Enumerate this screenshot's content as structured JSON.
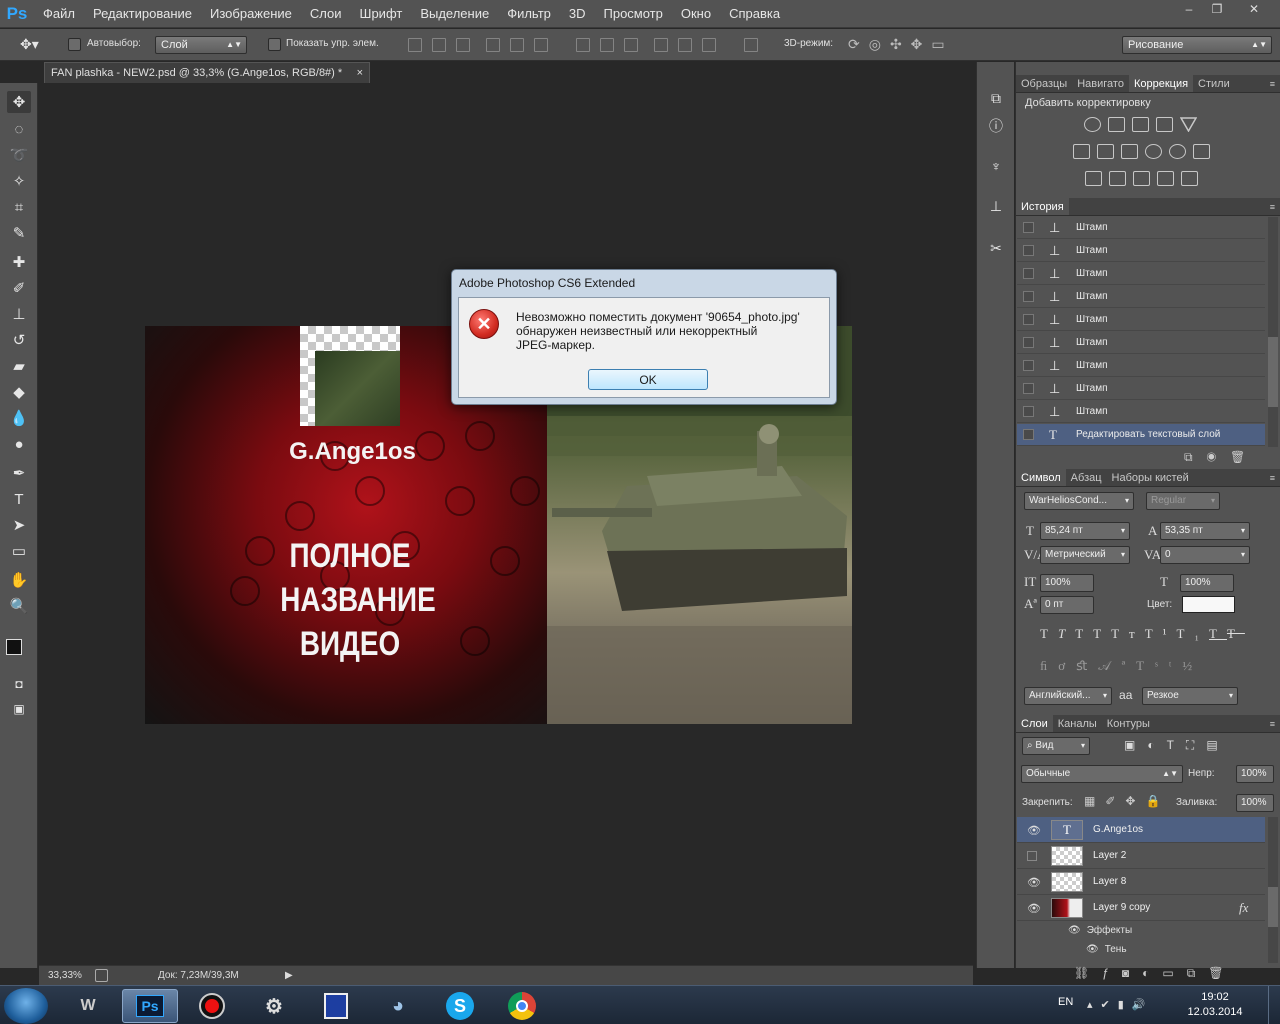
{
  "menubar": {
    "logo": "Ps",
    "items": [
      "Файл",
      "Редактирование",
      "Изображение",
      "Слои",
      "Шрифт",
      "Выделение",
      "Фильтр",
      "3D",
      "Просмотр",
      "Окно",
      "Справка"
    ],
    "window_buttons": {
      "minimize": "–",
      "maximize": "❐",
      "close": "✕"
    }
  },
  "options_bar": {
    "autoselect_label": "Автовыбор:",
    "autoselect_value": "Слой",
    "show_transform_label": "Показать упр. элем.",
    "mode_3d_label": "3D-режим:",
    "workspace_value": "Рисование"
  },
  "document": {
    "tab_title": "FAN plashka - NEW2.psd @ 33,3% (G.Ange1os, RGB/8#) *",
    "tab_close": "×",
    "zoom": "33,33%",
    "doc_size": "Док: 7,23M/39,3M"
  },
  "artwork": {
    "nickname": "G.Ange1os",
    "title_lines": [
      "ПОЛНОЕ",
      "НАЗВАНИЕ",
      "ВИДЕО"
    ]
  },
  "dialog": {
    "title": "Adobe Photoshop CS6 Extended",
    "icon": "error-icon",
    "message_line1": "Невозможно поместить документ '90654_photo.jpg'",
    "message_line2": "обнаружен неизвестный или некорректный",
    "message_line3": "JPEG-маркер.",
    "ok_label": "OK"
  },
  "panels": {
    "top_tabs": [
      "Образцы",
      "Навигато",
      "Коррекция",
      "Стили"
    ],
    "adjustments_heading": "Добавить корректировку",
    "history_tab": "История",
    "history_items": [
      "Штамп",
      "Штамп",
      "Штамп",
      "Штамп",
      "Штамп",
      "Штамп",
      "Штамп",
      "Штамп",
      "Штамп",
      "Редактировать текстовый слой"
    ],
    "char_tabs": [
      "Символ",
      "Абзац",
      "Наборы кистей"
    ],
    "font_family": "WarHeliosCond...",
    "font_style": "Regular",
    "font_size": "85,24 пт",
    "leading": "53,35 пт",
    "kerning": "Метрический",
    "tracking": "0",
    "vscale": "100%",
    "hscale": "100%",
    "baseline": "0 пт",
    "color_label": "Цвет:",
    "language": "Английский...",
    "aa_label": "a",
    "antialias": "Резкое",
    "layers_tabs": [
      "Слои",
      "Каналы",
      "Контуры"
    ],
    "layer_filter": "Вид",
    "blend_mode": "Обычные",
    "opacity_label": "Непр:",
    "opacity": "100%",
    "lock_label": "Закрепить:",
    "fill_label": "Заливка:",
    "fill": "100%",
    "layers": [
      {
        "name": "G.Ange1os",
        "selected": true,
        "visible": true
      },
      {
        "name": "Layer 2",
        "selected": false,
        "visible": false
      },
      {
        "name": "Layer 8",
        "selected": false,
        "visible": true
      },
      {
        "name": "Layer 9 copy",
        "selected": false,
        "visible": true
      }
    ],
    "effects_label": "Эффекты",
    "shadow_label": "Тень",
    "fx_label": "fx"
  },
  "taskbar": {
    "lang": "EN",
    "time": "19:02",
    "date": "12.03.2014"
  }
}
